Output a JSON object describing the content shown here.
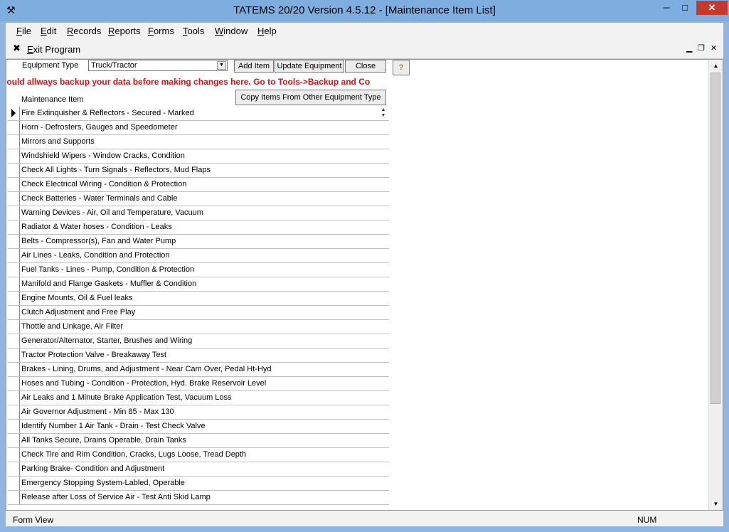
{
  "window": {
    "title": "TATEMS 20/20 Version 4.5.12 - [Maintenance Item List]",
    "min_icon": "minimize-icon",
    "max_icon": "maximize-icon",
    "close_icon": "close-icon"
  },
  "menu": {
    "items": [
      "File",
      "Edit",
      "Records",
      "Reports",
      "Forms",
      "Tools",
      "Window",
      "Help"
    ]
  },
  "toolbar": {
    "exit_label": "Exit Program"
  },
  "form": {
    "equipment_type_label": "Equipment Type",
    "equipment_type_value": "Truck/Tractor",
    "add_item": "Add Item",
    "update_equipment": "Update Equipment",
    "close": "Close",
    "help_icon": "?",
    "warning": "hould allways backup your data before making changes here. Go to Tools->Backup and Co",
    "maintenance_item_label": "Maintenance Item",
    "copy_items": "Copy Items From Other Equipment Type",
    "items": [
      "Fire Extinquisher & Reflectors - Secured - Marked",
      "Horn - Defrosters, Gauges and Speedometer",
      "Mirrors and Supports",
      "Windshield Wipers - Window Cracks, Condition",
      "Check All Lights - Turn Signals - Reflectors, Mud Flaps",
      "Check Electrical Wiring - Condition & Protection",
      "Check Batteries - Water Terminals and Cable",
      "Warning Devices - Air, Oil and Temperature, Vacuum",
      "Radiator & Water hoses - Condition - Leaks",
      "Belts - Compressor(s), Fan and Water Pump",
      "Air Lines - Leaks, Condition and Protection",
      "Fuel Tanks - Lines - Pump, Condition & Protection",
      "Manifold and Flange Gaskets - Muffler & Condition",
      "Engine Mounts, Oil & Fuel leaks",
      "Clutch Adjustment and Free Play",
      "Thottle and Linkage, Air Filter",
      "Generator/Alternator, Starter, Brushes and Wiring",
      "Tractor Protection Valve - Breakaway Test",
      "Brakes - Lining, Drums, and Adjustment - Near Cam Over, Pedal Ht-Hyd",
      "Hoses and Tubing - Condition - Protection, Hyd. Brake Reservoir Level",
      "Air Leaks and 1 Minute Brake Application Test, Vacuum Loss",
      "Air Governor Adjustment - Min 85 - Max 130",
      "Identify Number 1 Air Tank - Drain - Test Check Valve",
      "All Tanks Secure, Drains Operable, Drain Tanks",
      "Check Tire and Rim Condition, Cracks, Lugs Loose, Tread Depth",
      "Parking Brake- Condition and Adjustment",
      "Emergency Stopping System-Labled, Operable",
      "Release after Loss of Service Air - Test Anti Skid Lamp"
    ]
  },
  "status": {
    "left": "Form View",
    "right": "NUM"
  }
}
